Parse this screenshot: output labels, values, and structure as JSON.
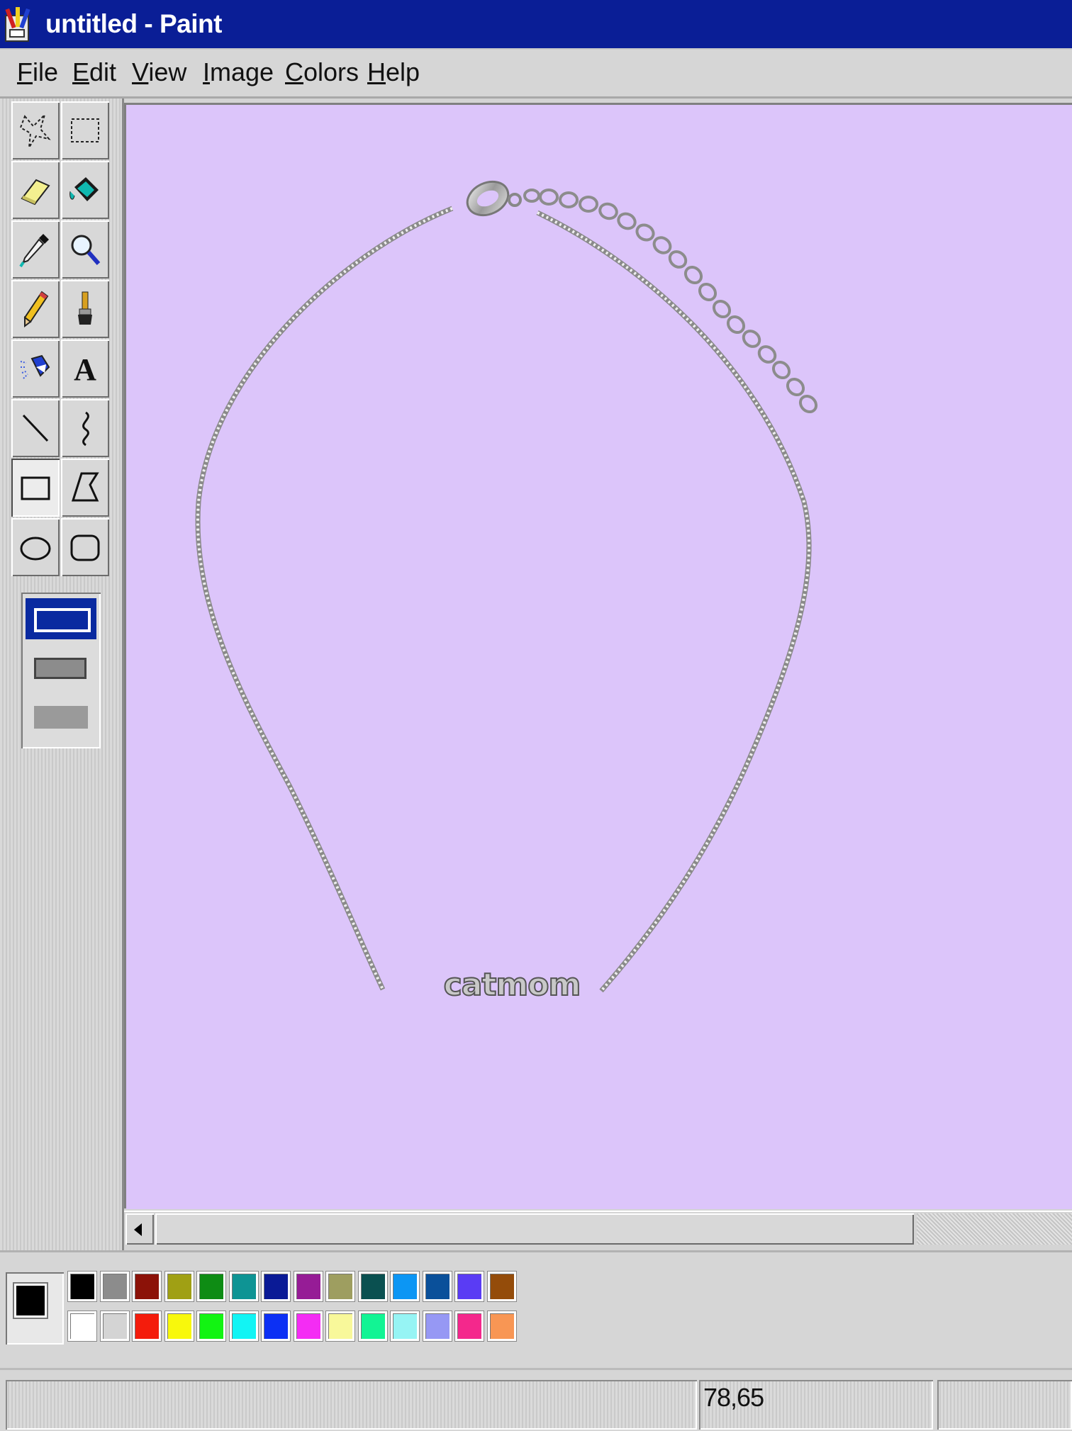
{
  "window": {
    "title": "untitled - Paint"
  },
  "menu": [
    {
      "label": "File",
      "mnemonic": "F",
      "rest": "ile"
    },
    {
      "label": "Edit",
      "mnemonic": "E",
      "rest": "dit"
    },
    {
      "label": "View",
      "mnemonic": "V",
      "rest": "iew"
    },
    {
      "label": "Image",
      "mnemonic": "I",
      "rest": "mage"
    },
    {
      "label": "Colors",
      "mnemonic": "C",
      "rest": "olors"
    },
    {
      "label": "Help",
      "mnemonic": "H",
      "rest": "elp"
    }
  ],
  "tools": [
    {
      "name": "free-form-select-icon",
      "active": false
    },
    {
      "name": "rectangle-select-icon",
      "active": false
    },
    {
      "name": "eraser-icon",
      "active": false
    },
    {
      "name": "fill-bucket-icon",
      "active": false
    },
    {
      "name": "color-picker-icon",
      "active": false
    },
    {
      "name": "magnifier-icon",
      "active": false
    },
    {
      "name": "pencil-icon",
      "active": false
    },
    {
      "name": "brush-icon",
      "active": false
    },
    {
      "name": "airbrush-icon",
      "active": false
    },
    {
      "name": "text-tool-icon",
      "active": false,
      "glyph": "A"
    },
    {
      "name": "line-tool-icon",
      "active": false
    },
    {
      "name": "curve-tool-icon",
      "active": false
    },
    {
      "name": "rectangle-tool-icon",
      "active": true
    },
    {
      "name": "polygon-tool-icon",
      "active": false
    },
    {
      "name": "ellipse-tool-icon",
      "active": false
    },
    {
      "name": "rounded-rectangle-tool-icon",
      "active": false
    }
  ],
  "canvas": {
    "background_color": "#dcc5fa",
    "image": "silver necklace with catmom pendant",
    "pendant_text": "catmom"
  },
  "colors": {
    "foreground": "#000000",
    "background": "#ffffff",
    "palette_top": [
      "#000000",
      "#8c8c8c",
      "#8c1208",
      "#a0a014",
      "#0e8c14",
      "#0e9494",
      "#0a1a96",
      "#961c96",
      "#9e9e60",
      "#0a5050",
      "#0c96f4",
      "#0a509a",
      "#5a3cf4",
      "#944c0a"
    ],
    "palette_bottom": [
      "#ffffff",
      "#d4d4d4",
      "#f41c0c",
      "#f8f80c",
      "#12f412",
      "#12f4f4",
      "#0c30f4",
      "#f42cf4",
      "#f8f89a",
      "#12f494",
      "#96f4f4",
      "#9698f4",
      "#f4288c",
      "#f89654"
    ]
  },
  "status": {
    "coords": "78,65"
  }
}
